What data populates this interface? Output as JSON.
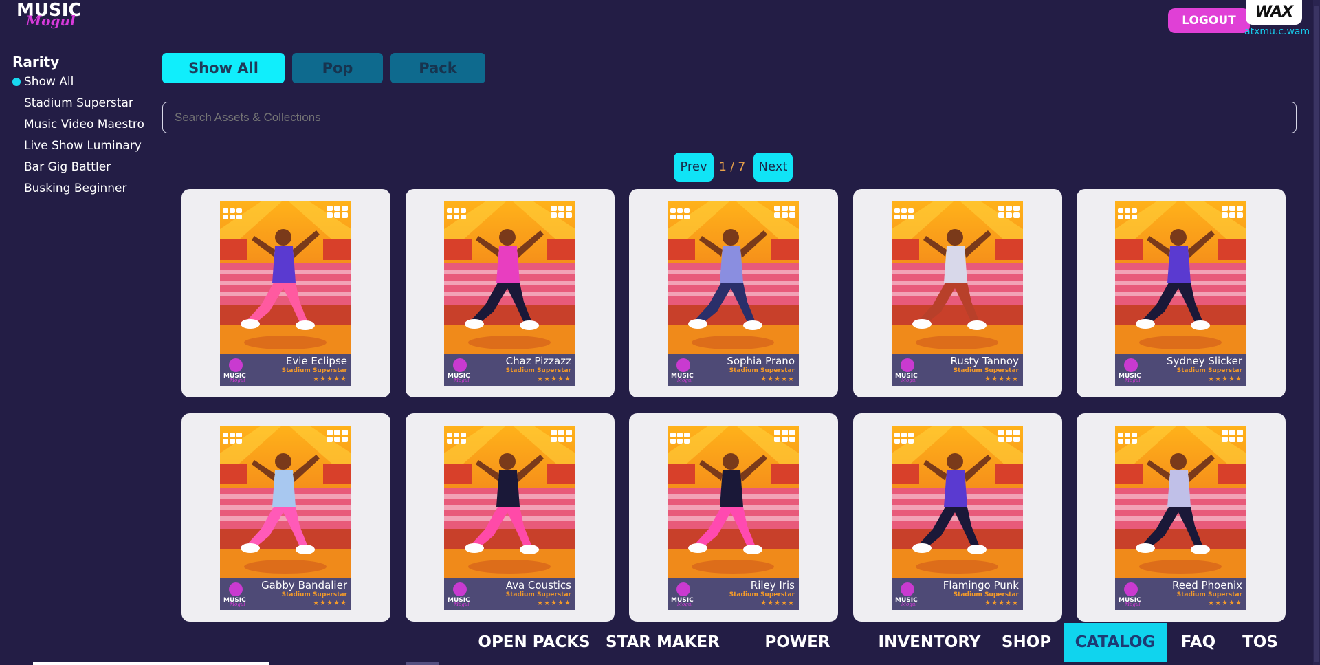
{
  "header": {
    "logo_line1": "MUSIC",
    "logo_line2": "Mogul",
    "logout_label": "LOGOUT",
    "wallet_badge": "WAX",
    "username": "atxmu.c.wam"
  },
  "sidebar": {
    "title": "Rarity",
    "items": [
      {
        "label": "Show All",
        "selected": true
      },
      {
        "label": "Stadium Superstar"
      },
      {
        "label": "Music Video Maestro"
      },
      {
        "label": "Live Show Luminary"
      },
      {
        "label": "Bar Gig Battler"
      },
      {
        "label": "Busking Beginner"
      }
    ]
  },
  "filters": {
    "show_all": "Show All",
    "pop": "Pop",
    "pack": "Pack",
    "active": "Show All"
  },
  "search": {
    "placeholder": "Search Assets & Collections"
  },
  "pagination": {
    "prev": "Prev",
    "indicator": "1 / 7",
    "next": "Next"
  },
  "card_brand": {
    "line1": "MUSIC",
    "line2": "Mogul"
  },
  "cards": [
    {
      "name": "Evie Eclipse",
      "rarity": "Stadium Superstar",
      "stars": "★★★★★",
      "outfit": "#5a3ad0",
      "accent": "#ff5aa0"
    },
    {
      "name": "Chaz Pizzazz",
      "rarity": "Stadium Superstar",
      "stars": "★★★★★",
      "outfit": "#e83ec0",
      "accent": "#1a1838"
    },
    {
      "name": "Sophia Prano",
      "rarity": "Stadium Superstar",
      "stars": "★★★★★",
      "outfit": "#8a8ee0",
      "accent": "#2a2f6a"
    },
    {
      "name": "Rusty Tannoy",
      "rarity": "Stadium Superstar",
      "stars": "★★★★★",
      "outfit": "#d8d8ea",
      "accent": "#b8402a"
    },
    {
      "name": "Sydney Slicker",
      "rarity": "Stadium Superstar",
      "stars": "★★★★★",
      "outfit": "#5a3ad0",
      "accent": "#1a1838"
    },
    {
      "name": "Gabby Bandalier",
      "rarity": "Stadium Superstar",
      "stars": "★★★★★",
      "outfit": "#a8c8f0",
      "accent": "#ff5ab8"
    },
    {
      "name": "Ava Coustics",
      "rarity": "Stadium Superstar",
      "stars": "★★★★★",
      "outfit": "#1a1838",
      "accent": "#ff4aa8"
    },
    {
      "name": "Riley Iris",
      "rarity": "Stadium Superstar",
      "stars": "★★★★★",
      "outfit": "#1a1838",
      "accent": "#ff4ab0"
    },
    {
      "name": "Flamingo Punk",
      "rarity": "Stadium Superstar",
      "stars": "★★★★★",
      "outfit": "#5a3ad0",
      "accent": "#1a1838"
    },
    {
      "name": "Reed Phoenix",
      "rarity": "Stadium Superstar",
      "stars": "★★★★★",
      "outfit": "#c0c0e8",
      "accent": "#1a1838"
    }
  ],
  "nav": {
    "items": [
      "OPEN PACKS",
      "STAR MAKER",
      "POWER SCORE",
      "INVENTORY",
      "SHOP",
      "CATALOG",
      "FAQ",
      "TOS"
    ],
    "active": "CATALOG"
  },
  "colors": {
    "background": "#231d45",
    "accent_cyan": "#10eefc",
    "logout_pink": "#e040d6",
    "pager_text": "#e9a24a"
  }
}
